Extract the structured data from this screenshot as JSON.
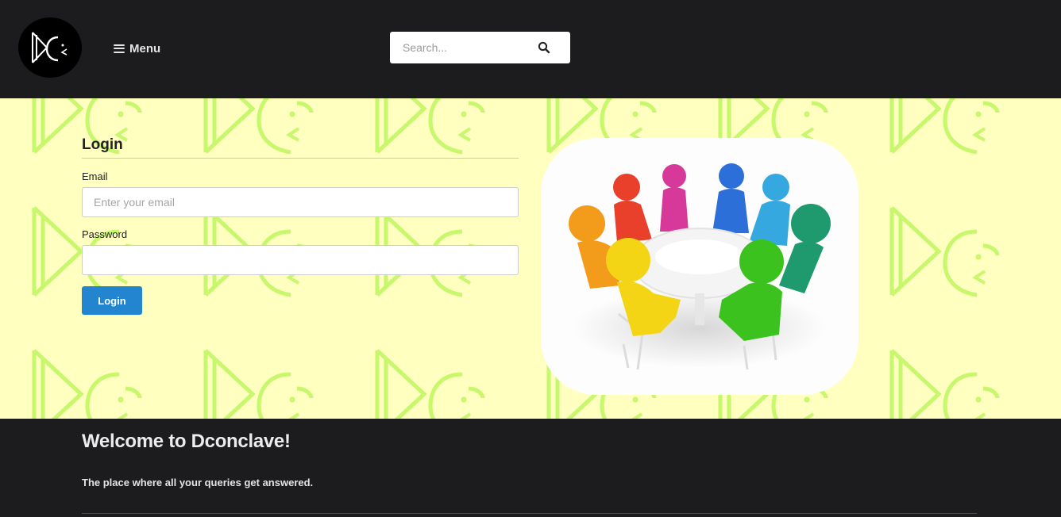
{
  "header": {
    "menu_label": "Menu",
    "search_placeholder": "Search...",
    "logo_icon": "dc-logo-icon",
    "search_icon": "search-icon"
  },
  "login": {
    "title": "Login",
    "email_label": "Email",
    "email_placeholder": "Enter your email",
    "email_value": "",
    "password_label": "Password",
    "password_value": "",
    "button_label": "Login"
  },
  "hero": {
    "image": "people-round-table-illustration"
  },
  "footer": {
    "welcome_title": "Welcome to Dconclave!",
    "tagline": "The place where all your queries get answered."
  },
  "colors": {
    "topbar": "#1c1c1e",
    "hero_background": "#ffffc0",
    "pattern": "#c6f76c",
    "button": "#2385d0"
  }
}
